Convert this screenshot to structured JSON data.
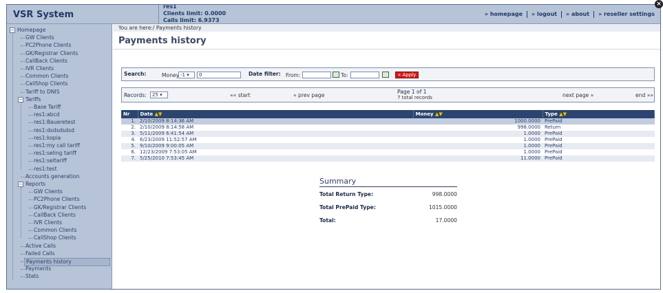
{
  "header": {
    "title": "VSR System",
    "account_lines": [
      "res1",
      "Clients limit: 0.0000",
      "Calls limit: 6.9373"
    ],
    "nav": [
      "» homepage",
      "» logout",
      "» about",
      "» reseller settings"
    ]
  },
  "sidebar": {
    "items": [
      {
        "label": "Homepage",
        "level": 0,
        "toggle": "-"
      },
      {
        "label": "GW Clients",
        "level": 1
      },
      {
        "label": "PC2Phone Clients",
        "level": 1
      },
      {
        "label": "GK/Registrar Clients",
        "level": 1
      },
      {
        "label": "CallBack Clients",
        "level": 1
      },
      {
        "label": "IVR Clients",
        "level": 1
      },
      {
        "label": "Common Clients",
        "level": 1
      },
      {
        "label": "CallShop Clients",
        "level": 1
      },
      {
        "label": "Tariff to DNIS",
        "level": 1
      },
      {
        "label": "Tariffs",
        "level": 1,
        "toggle": "-"
      },
      {
        "label": "Base Tariff",
        "level": 2
      },
      {
        "label": "res1:abcd",
        "level": 2
      },
      {
        "label": "res1:Baueretest",
        "level": 2
      },
      {
        "label": "res1:dsdsdsdsd",
        "level": 2
      },
      {
        "label": "res1:kopia",
        "level": 2
      },
      {
        "label": "res1:my call tariff",
        "level": 2
      },
      {
        "label": "res1:seling tariff",
        "level": 2
      },
      {
        "label": "res1:seltariff",
        "level": 2
      },
      {
        "label": "res1:test",
        "level": 2
      },
      {
        "label": "Accounts generation",
        "level": 1
      },
      {
        "label": "Reports",
        "level": 1,
        "toggle": "-"
      },
      {
        "label": "GW Clients",
        "level": 2
      },
      {
        "label": "PC2Phone Clients",
        "level": 2
      },
      {
        "label": "GK/Registrar Clients",
        "level": 2
      },
      {
        "label": "CallBack Clients",
        "level": 2
      },
      {
        "label": "IVR Clients",
        "level": 2
      },
      {
        "label": "Common Clients",
        "level": 2
      },
      {
        "label": "CallShop Clients",
        "level": 2
      },
      {
        "label": "Active Calls",
        "level": 1
      },
      {
        "label": "Failed Calls",
        "level": 1
      },
      {
        "label": "Payments history",
        "level": 1,
        "selected": true
      },
      {
        "label": "Payments",
        "level": 1
      },
      {
        "label": "Stats",
        "level": 1
      }
    ]
  },
  "main": {
    "breadcrumb": "You are here:/ Payments history",
    "page_title": "Payments history",
    "search": {
      "label": "Search:",
      "money_label": "Money",
      "money_operator": "-1",
      "money_value": "0",
      "date_filter_label": "Date filter:",
      "from_label": "From:",
      "from_value": "",
      "to_label": "To:",
      "to_value": "",
      "apply_label": "» Apply"
    },
    "pager": {
      "records_label": "Records:",
      "records_per_page": "25",
      "start": "«« start",
      "prev": "« prev page",
      "page_info": "Page 1 of 1",
      "total_records": "7 total records",
      "next": "next page »",
      "end": "end »»"
    },
    "table": {
      "headers": [
        "Nr",
        "Date",
        "Money",
        "Type"
      ],
      "sort_arrows": "▲▼",
      "rows": [
        [
          "1.",
          "2/10/2009 8:14:36 AM",
          "1000.0000",
          "PrePaid"
        ],
        [
          "2.",
          "2/10/2009 8:14:58 AM",
          "998.0000",
          "Return"
        ],
        [
          "3.",
          "5/11/2009 6:41:54 AM",
          "1.0000",
          "PrePaid"
        ],
        [
          "4.",
          "6/23/2009 11:52:57 AM",
          "1.0000",
          "PrePaid"
        ],
        [
          "5.",
          "9/10/2009 9:00:05 AM",
          "1.0000",
          "PrePaid"
        ],
        [
          "6.",
          "12/23/2009 7:53:05 AM",
          "1.0000",
          "PrePaid"
        ],
        [
          "7.",
          "5/25/2010 7:53:45 AM",
          "11.0000",
          "PrePaid"
        ]
      ]
    },
    "summary": {
      "title": "Summary",
      "rows": [
        {
          "label": "Total Return Type:",
          "value": "998.0000"
        },
        {
          "label": "Total PrePaid Type:",
          "value": "1015.0000"
        },
        {
          "label": "Total:",
          "value": "17.0000"
        }
      ]
    }
  },
  "colors": {
    "sidebar_bg": "#b7c4d8",
    "table_header": "#2b4570",
    "apply_button": "#cc1c1c"
  }
}
